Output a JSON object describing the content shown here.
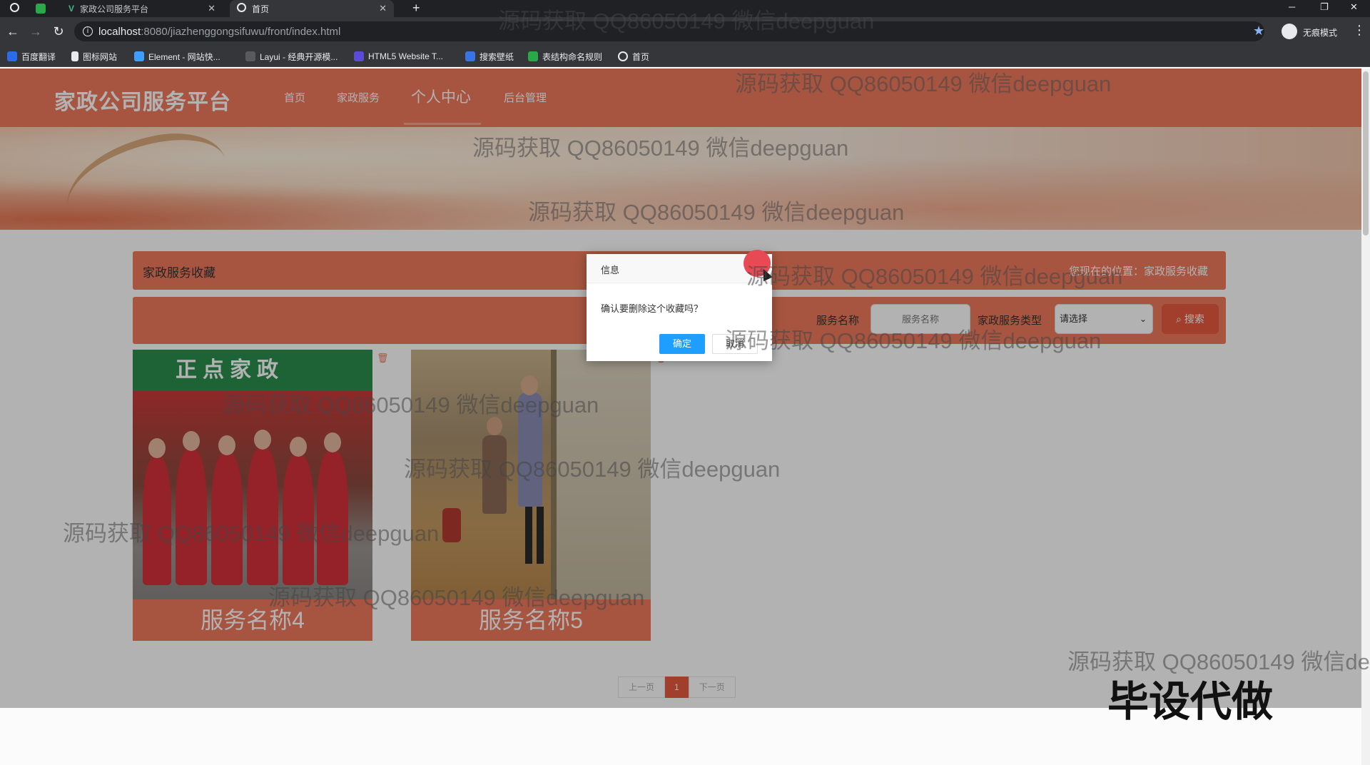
{
  "browser": {
    "tabs": [
      {
        "label": "家政公司服务平台",
        "active": false
      },
      {
        "label": "首页",
        "active": true
      }
    ],
    "new_tab": "+",
    "url": {
      "host": "localhost",
      "rest": ":8080/jiazhenggongsifuwu/front/index.html"
    },
    "profile_label": "无痕模式",
    "bookmarks": [
      "百度翻译",
      "图标网站",
      "Element - 网站快...",
      "Layui - 经典开源模...",
      "HTML5 Website T...",
      "搜索壁纸",
      "表结构命名规则",
      "首页"
    ]
  },
  "site": {
    "title": "家政公司服务平台",
    "nav": [
      "首页",
      "家政服务",
      "个人中心",
      "后台管理"
    ],
    "active_nav": "个人中心"
  },
  "breadcrumb": {
    "title": "家政服务收藏",
    "location": "您现在的位置：家政服务收藏"
  },
  "filter": {
    "name_label": "服务名称",
    "name_placeholder": "服务名称",
    "type_label": "家政服务类型",
    "type_selected": "请选择",
    "search_label": "搜索"
  },
  "cards": [
    {
      "caption": "服务名称4",
      "sign_text": "正点家政"
    },
    {
      "caption": "服务名称5"
    }
  ],
  "pagination": {
    "prev": "上一页",
    "current": "1",
    "next": "下一页"
  },
  "dialog": {
    "title": "信息",
    "message": "确认要删除这个收藏吗？",
    "ok": "确定",
    "cancel": "取消"
  },
  "watermark": {
    "text": "源码获取 QQ86050149 微信deepguan",
    "text_cut": "源码获取 QQ86050149 微信de",
    "badge": "毕设代做"
  },
  "colors": {
    "accent": "#f07a5d",
    "search_button": "#e85a3f",
    "dialog_ok": "#1e9fff"
  }
}
